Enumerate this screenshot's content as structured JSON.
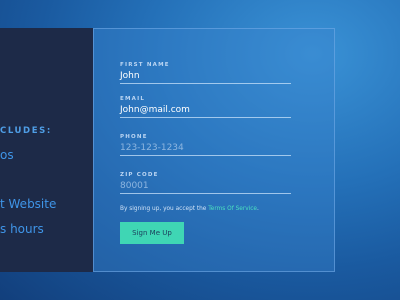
{
  "left_panel": {
    "heading": "CLUDES:",
    "features": [
      "os",
      "t Website",
      "s hours"
    ]
  },
  "form": {
    "fields": [
      {
        "label": "FIRST NAME",
        "value": "John"
      },
      {
        "label": "EMAIL",
        "value": "John@mail.com"
      },
      {
        "label": "PHONE",
        "placeholder": "123-123-1234"
      },
      {
        "label": "ZIP CODE",
        "placeholder": "80001"
      }
    ],
    "terms_prefix": "By signing up, you accept the ",
    "terms_link": "Terms Of Service",
    "terms_suffix": ".",
    "submit_label": "Sign Me Up"
  },
  "colors": {
    "accent": "#3fd6b4",
    "link": "#4be0c0",
    "feature_text": "#3f95e8",
    "left_panel_bg": "#1d2a48"
  }
}
